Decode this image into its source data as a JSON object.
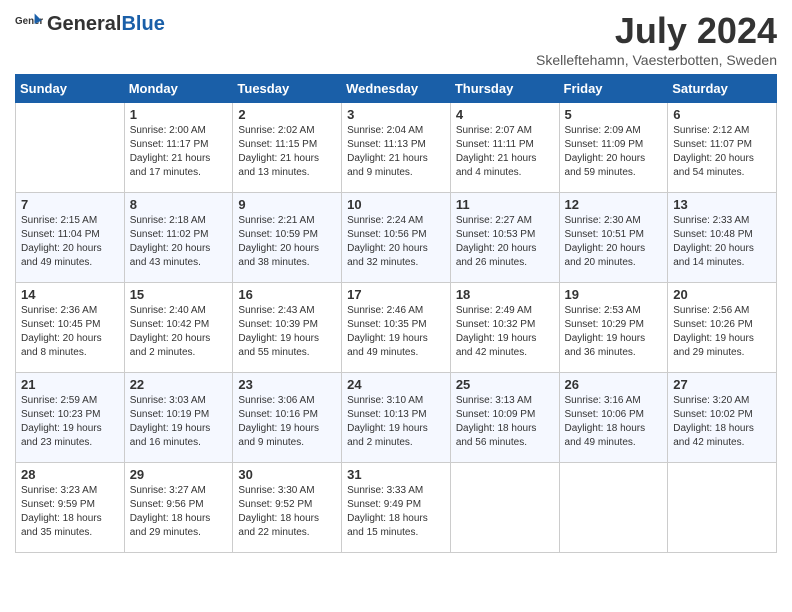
{
  "header": {
    "logo_general": "General",
    "logo_blue": "Blue",
    "month_title": "July 2024",
    "location": "Skelleftehamn, Vaesterbotten, Sweden"
  },
  "weekdays": [
    "Sunday",
    "Monday",
    "Tuesday",
    "Wednesday",
    "Thursday",
    "Friday",
    "Saturday"
  ],
  "weeks": [
    [
      {
        "day": "",
        "sunrise": "",
        "sunset": "",
        "daylight": ""
      },
      {
        "day": "1",
        "sunrise": "Sunrise: 2:00 AM",
        "sunset": "Sunset: 11:17 PM",
        "daylight": "Daylight: 21 hours and 17 minutes."
      },
      {
        "day": "2",
        "sunrise": "Sunrise: 2:02 AM",
        "sunset": "Sunset: 11:15 PM",
        "daylight": "Daylight: 21 hours and 13 minutes."
      },
      {
        "day": "3",
        "sunrise": "Sunrise: 2:04 AM",
        "sunset": "Sunset: 11:13 PM",
        "daylight": "Daylight: 21 hours and 9 minutes."
      },
      {
        "day": "4",
        "sunrise": "Sunrise: 2:07 AM",
        "sunset": "Sunset: 11:11 PM",
        "daylight": "Daylight: 21 hours and 4 minutes."
      },
      {
        "day": "5",
        "sunrise": "Sunrise: 2:09 AM",
        "sunset": "Sunset: 11:09 PM",
        "daylight": "Daylight: 20 hours and 59 minutes."
      },
      {
        "day": "6",
        "sunrise": "Sunrise: 2:12 AM",
        "sunset": "Sunset: 11:07 PM",
        "daylight": "Daylight: 20 hours and 54 minutes."
      }
    ],
    [
      {
        "day": "7",
        "sunrise": "Sunrise: 2:15 AM",
        "sunset": "Sunset: 11:04 PM",
        "daylight": "Daylight: 20 hours and 49 minutes."
      },
      {
        "day": "8",
        "sunrise": "Sunrise: 2:18 AM",
        "sunset": "Sunset: 11:02 PM",
        "daylight": "Daylight: 20 hours and 43 minutes."
      },
      {
        "day": "9",
        "sunrise": "Sunrise: 2:21 AM",
        "sunset": "Sunset: 10:59 PM",
        "daylight": "Daylight: 20 hours and 38 minutes."
      },
      {
        "day": "10",
        "sunrise": "Sunrise: 2:24 AM",
        "sunset": "Sunset: 10:56 PM",
        "daylight": "Daylight: 20 hours and 32 minutes."
      },
      {
        "day": "11",
        "sunrise": "Sunrise: 2:27 AM",
        "sunset": "Sunset: 10:53 PM",
        "daylight": "Daylight: 20 hours and 26 minutes."
      },
      {
        "day": "12",
        "sunrise": "Sunrise: 2:30 AM",
        "sunset": "Sunset: 10:51 PM",
        "daylight": "Daylight: 20 hours and 20 minutes."
      },
      {
        "day": "13",
        "sunrise": "Sunrise: 2:33 AM",
        "sunset": "Sunset: 10:48 PM",
        "daylight": "Daylight: 20 hours and 14 minutes."
      }
    ],
    [
      {
        "day": "14",
        "sunrise": "Sunrise: 2:36 AM",
        "sunset": "Sunset: 10:45 PM",
        "daylight": "Daylight: 20 hours and 8 minutes."
      },
      {
        "day": "15",
        "sunrise": "Sunrise: 2:40 AM",
        "sunset": "Sunset: 10:42 PM",
        "daylight": "Daylight: 20 hours and 2 minutes."
      },
      {
        "day": "16",
        "sunrise": "Sunrise: 2:43 AM",
        "sunset": "Sunset: 10:39 PM",
        "daylight": "Daylight: 19 hours and 55 minutes."
      },
      {
        "day": "17",
        "sunrise": "Sunrise: 2:46 AM",
        "sunset": "Sunset: 10:35 PM",
        "daylight": "Daylight: 19 hours and 49 minutes."
      },
      {
        "day": "18",
        "sunrise": "Sunrise: 2:49 AM",
        "sunset": "Sunset: 10:32 PM",
        "daylight": "Daylight: 19 hours and 42 minutes."
      },
      {
        "day": "19",
        "sunrise": "Sunrise: 2:53 AM",
        "sunset": "Sunset: 10:29 PM",
        "daylight": "Daylight: 19 hours and 36 minutes."
      },
      {
        "day": "20",
        "sunrise": "Sunrise: 2:56 AM",
        "sunset": "Sunset: 10:26 PM",
        "daylight": "Daylight: 19 hours and 29 minutes."
      }
    ],
    [
      {
        "day": "21",
        "sunrise": "Sunrise: 2:59 AM",
        "sunset": "Sunset: 10:23 PM",
        "daylight": "Daylight: 19 hours and 23 minutes."
      },
      {
        "day": "22",
        "sunrise": "Sunrise: 3:03 AM",
        "sunset": "Sunset: 10:19 PM",
        "daylight": "Daylight: 19 hours and 16 minutes."
      },
      {
        "day": "23",
        "sunrise": "Sunrise: 3:06 AM",
        "sunset": "Sunset: 10:16 PM",
        "daylight": "Daylight: 19 hours and 9 minutes."
      },
      {
        "day": "24",
        "sunrise": "Sunrise: 3:10 AM",
        "sunset": "Sunset: 10:13 PM",
        "daylight": "Daylight: 19 hours and 2 minutes."
      },
      {
        "day": "25",
        "sunrise": "Sunrise: 3:13 AM",
        "sunset": "Sunset: 10:09 PM",
        "daylight": "Daylight: 18 hours and 56 minutes."
      },
      {
        "day": "26",
        "sunrise": "Sunrise: 3:16 AM",
        "sunset": "Sunset: 10:06 PM",
        "daylight": "Daylight: 18 hours and 49 minutes."
      },
      {
        "day": "27",
        "sunrise": "Sunrise: 3:20 AM",
        "sunset": "Sunset: 10:02 PM",
        "daylight": "Daylight: 18 hours and 42 minutes."
      }
    ],
    [
      {
        "day": "28",
        "sunrise": "Sunrise: 3:23 AM",
        "sunset": "Sunset: 9:59 PM",
        "daylight": "Daylight: 18 hours and 35 minutes."
      },
      {
        "day": "29",
        "sunrise": "Sunrise: 3:27 AM",
        "sunset": "Sunset: 9:56 PM",
        "daylight": "Daylight: 18 hours and 29 minutes."
      },
      {
        "day": "30",
        "sunrise": "Sunrise: 3:30 AM",
        "sunset": "Sunset: 9:52 PM",
        "daylight": "Daylight: 18 hours and 22 minutes."
      },
      {
        "day": "31",
        "sunrise": "Sunrise: 3:33 AM",
        "sunset": "Sunset: 9:49 PM",
        "daylight": "Daylight: 18 hours and 15 minutes."
      },
      {
        "day": "",
        "sunrise": "",
        "sunset": "",
        "daylight": ""
      },
      {
        "day": "",
        "sunrise": "",
        "sunset": "",
        "daylight": ""
      },
      {
        "day": "",
        "sunrise": "",
        "sunset": "",
        "daylight": ""
      }
    ]
  ]
}
